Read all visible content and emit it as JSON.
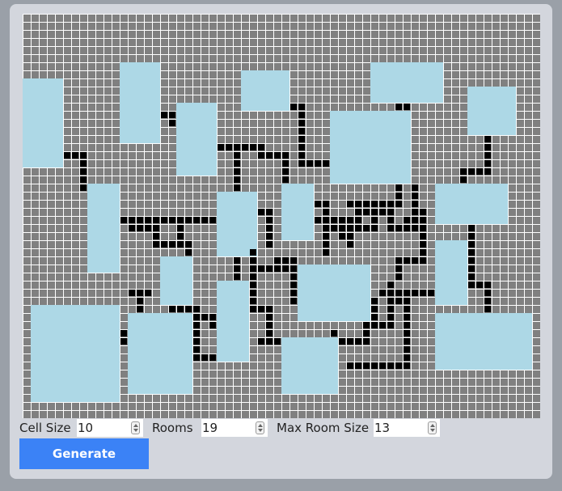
{
  "colors": {
    "page_bg": "#9aa0a8",
    "panel_bg": "#d3d6dd",
    "room": "#add8e6",
    "corridor": "#000000",
    "wall": "#808080",
    "grid_line": "#ffffff",
    "button_bg": "#3b82f6",
    "button_text": "#ffffff"
  },
  "controls": {
    "cell_size_label": "Cell Size",
    "cell_size_value": "10",
    "rooms_label": "Rooms",
    "rooms_value": "19",
    "max_room_size_label": "Max Room Size",
    "max_room_size_value": "13",
    "generate_label": "Generate"
  },
  "icons": [
    "spinner-icon"
  ]
}
